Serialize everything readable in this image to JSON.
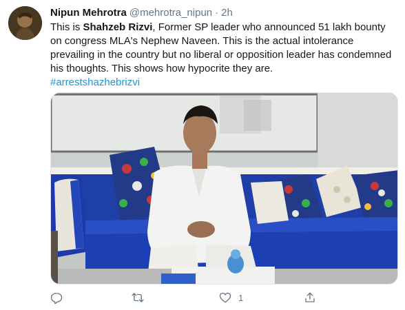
{
  "tweet": {
    "author": {
      "display_name": "Nipun Mehrotra",
      "handle": "@mehrotra_nipun",
      "separator": "·",
      "time": "2h"
    },
    "text": {
      "part1": "This is ",
      "bold_name": "Shahzeb Rizvi",
      "part2": ", Former SP leader who announced 51 lakh bounty on congress MLA's Nephew Naveen. This is the actual intolerance prevailing in the country but no liberal or opposition leader has condemned his thoughts. This shows how hypocrite they are.",
      "hashtag": "#arrestshazhebrizvi"
    },
    "actions": {
      "reply": {
        "icon": "reply-icon",
        "count": ""
      },
      "retweet": {
        "icon": "retweet-icon",
        "count": ""
      },
      "like": {
        "icon": "heart-icon",
        "count": "1"
      },
      "share": {
        "icon": "share-icon",
        "count": ""
      }
    },
    "colors": {
      "link": "#1b95e0",
      "muted": "#657786",
      "text": "#14171a"
    }
  }
}
